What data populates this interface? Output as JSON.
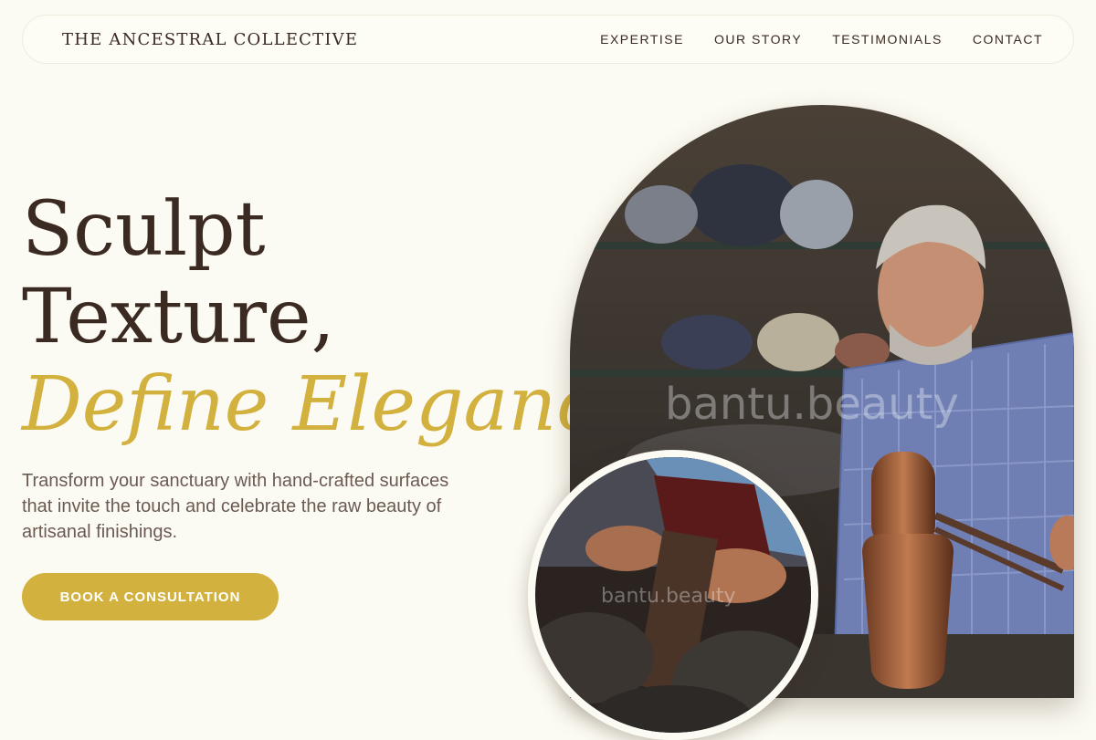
{
  "nav": {
    "brand": "THE ANCESTRAL COLLECTIVE",
    "items": [
      {
        "label": "EXPERTISE"
      },
      {
        "label": "OUR STORY"
      },
      {
        "label": "TESTIMONIALS"
      },
      {
        "label": "CONTACT"
      }
    ]
  },
  "hero": {
    "line1": "Sculpt",
    "line2": "Texture,",
    "line3": "Define Elegance.",
    "subtitle": "Transform your sanctuary with hand-crafted surfaces that invite the touch and celebrate the raw beauty of artisanal finishings.",
    "cta_label": "BOOK A CONSULTATION"
  },
  "images": {
    "main_watermark": "bantu.beauty",
    "inset_watermark": "bantu.beauty"
  },
  "colors": {
    "background": "#fcfbf3",
    "accent": "#d3b13f",
    "text_dark": "#3a2a22"
  }
}
